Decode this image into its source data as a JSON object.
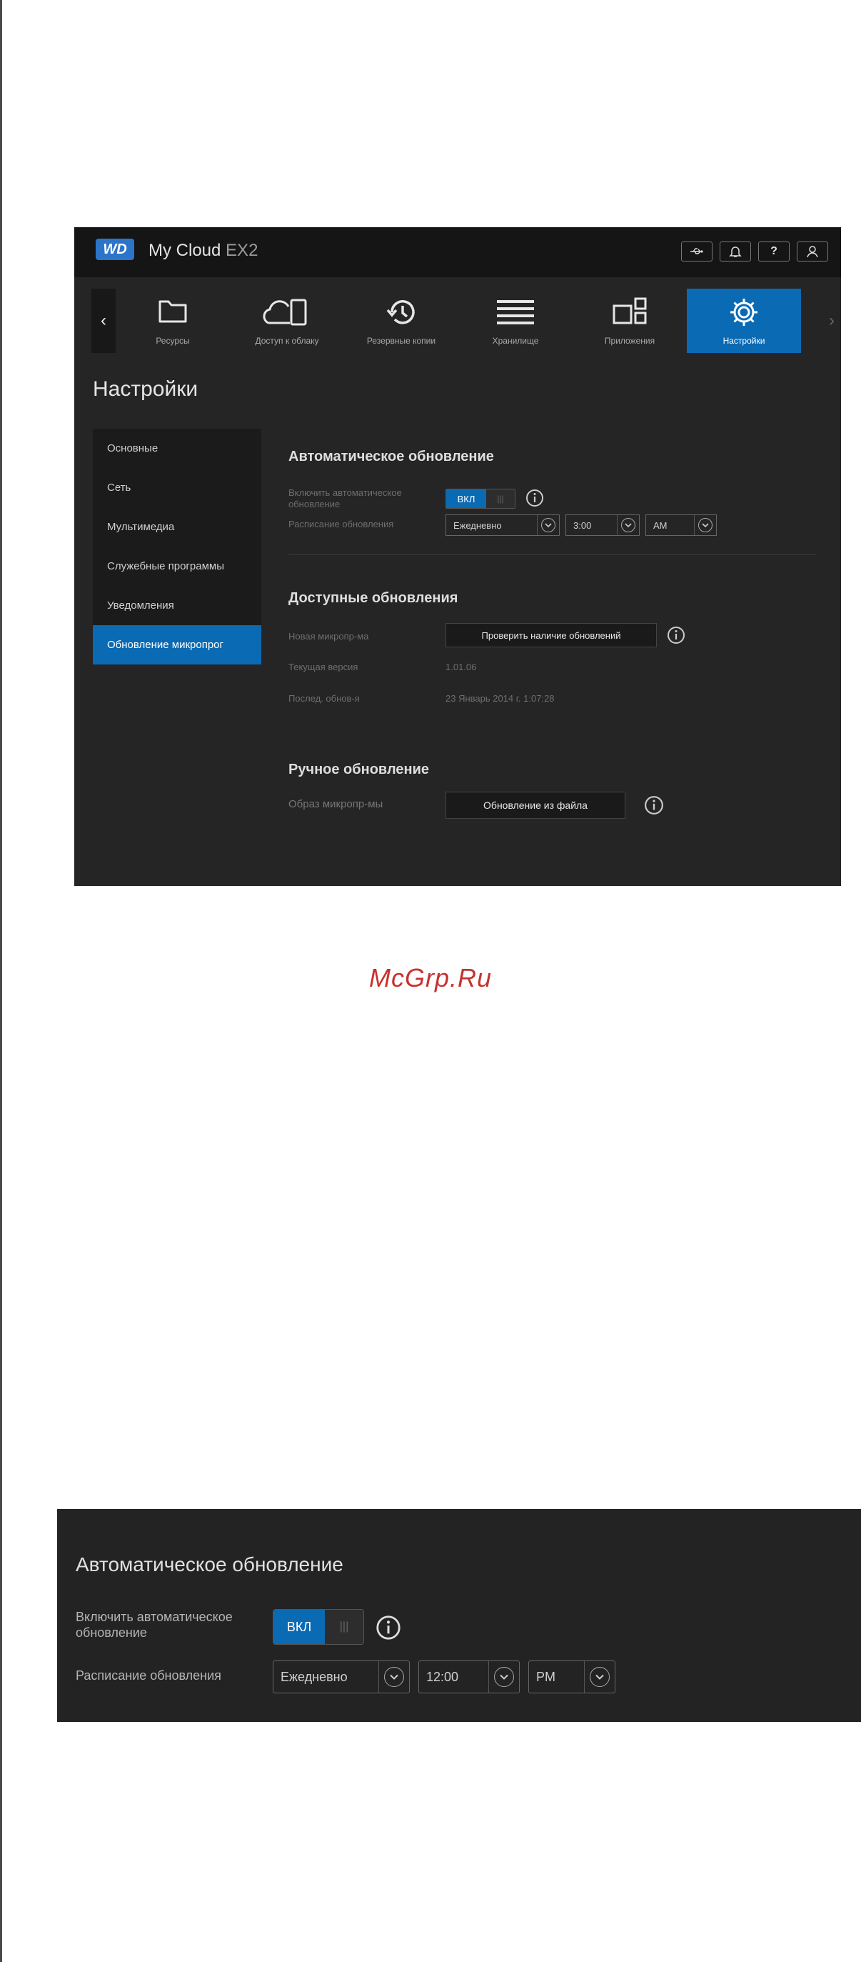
{
  "app": {
    "logo": "WD",
    "title_main": "My Cloud",
    "title_model": "EX2",
    "top_icons": [
      "usb-icon",
      "bell-icon",
      "help-icon",
      "user-icon"
    ],
    "help_glyph": "?"
  },
  "nav": {
    "items": [
      {
        "label": "Ресурсы",
        "icon": "folder-icon"
      },
      {
        "label": "Доступ к облаку",
        "icon": "cloud-device-icon"
      },
      {
        "label": "Резервные копии",
        "icon": "history-icon"
      },
      {
        "label": "Хранилище",
        "icon": "storage-icon"
      },
      {
        "label": "Приложения",
        "icon": "apps-icon"
      },
      {
        "label": "Настройки",
        "icon": "gear-icon",
        "active": true
      }
    ]
  },
  "page": {
    "heading": "Настройки"
  },
  "sidebar": {
    "items": [
      {
        "label": "Основные"
      },
      {
        "label": "Сеть"
      },
      {
        "label": "Мультимедиа"
      },
      {
        "label": "Служебные программы"
      },
      {
        "label": "Уведомления"
      },
      {
        "label": "Обновление микропрог",
        "active": true
      }
    ]
  },
  "auto_update": {
    "title": "Автоматическое обновление",
    "enable_label": "Включить автоматическое обновление",
    "toggle_on": "ВКЛ",
    "toggle_off": "|||",
    "schedule_label": "Расписание обновления",
    "frequency": "Ежедневно",
    "time": "3:00",
    "ampm": "AM"
  },
  "available_updates": {
    "title": "Доступные обновления",
    "new_fw_label": "Новая микропр-ма",
    "check_button": "Проверить наличие обновлений",
    "current_version_label": "Текущая версия",
    "current_version": "1.01.06",
    "last_update_label": "Послед. обнов-я",
    "last_update": "23 Январь 2014 г. 1:07:28"
  },
  "manual_update": {
    "title": "Ручное обновление",
    "image_label": "Образ микропр-мы",
    "file_button": "Обновление из файла"
  },
  "watermark": "McGrp.Ru",
  "detail": {
    "title": "Автоматическое обновление",
    "enable_label": "Включить автоматическое обновление",
    "toggle_on": "ВКЛ",
    "toggle_off": "|||",
    "schedule_label": "Расписание обновления",
    "frequency": "Ежедневно",
    "time": "12:00",
    "ampm": "PM"
  },
  "colors": {
    "accent": "#0a6ab4",
    "watermark": "#c6322f",
    "panel": "#252525"
  }
}
